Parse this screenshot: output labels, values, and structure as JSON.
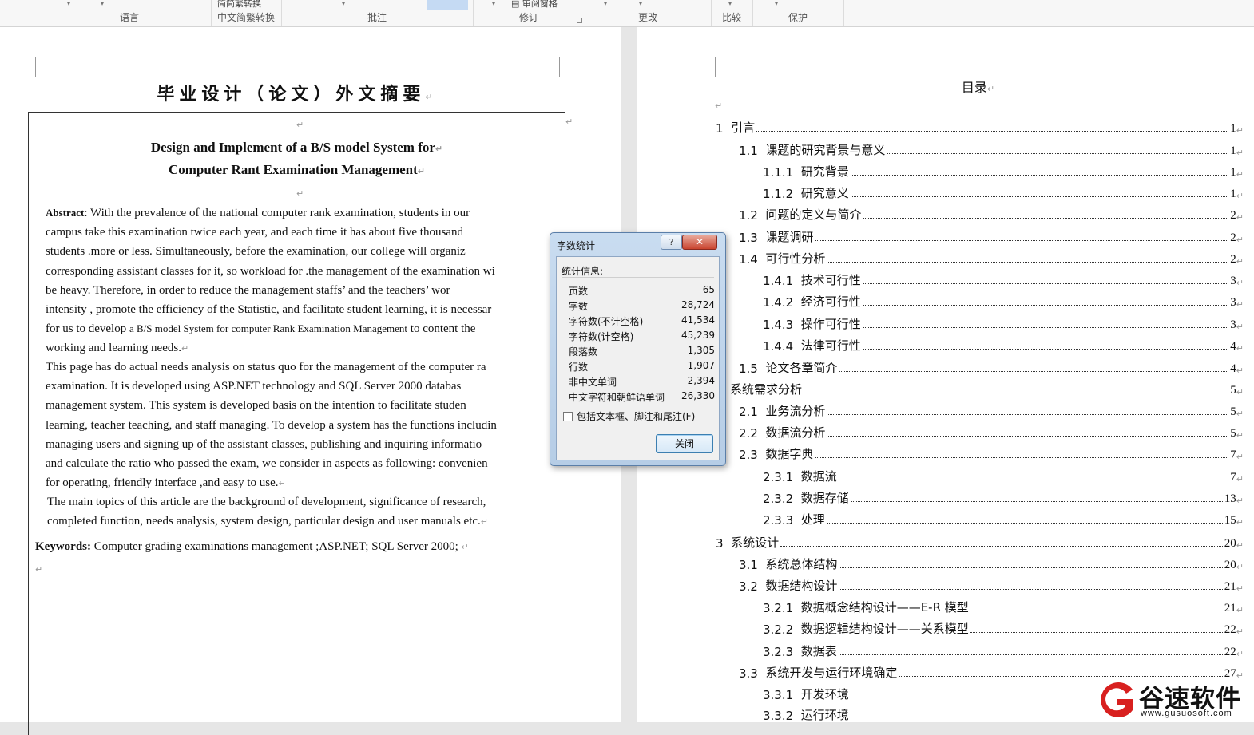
{
  "ribbon": {
    "groups": [
      {
        "label": "语言"
      },
      {
        "label": "中文简繁转换",
        "control": "简繁转换"
      },
      {
        "label": "批注"
      },
      {
        "label": "修订",
        "control": "审阅窗格"
      },
      {
        "label": "更改"
      },
      {
        "label": "比较"
      },
      {
        "label": "保护"
      }
    ]
  },
  "left_page": {
    "heading": "毕业设计（论文）外文摘要",
    "title_line1": "Design and Implement of a B/S model System for",
    "title_line2": "Computer Rant Examination Management",
    "abstract_label": "Abstract",
    "abstract_lines": [
      ": With the prevalence of the national computer rank examination, students in our",
      "campus take this examination twice each year, and each time it has about five thousand",
      "students .more or less. Simultaneously, before the examination, our college will organiz",
      "corresponding assistant classes for it, so workload for .the management of the examination wi",
      "be heavy. Therefore, in order to reduce the management staffs’ and the teachers’ wor",
      "intensity , promote the efficiency of the Statistic, and facilitate student learning, it is necessar",
      "for us to develop ",
      "working and learning needs."
    ],
    "abstract_line7_small": "a B/S model System for computer Rank Examination Management",
    "abstract_line7_end": " to content the",
    "para2_lines": [
      "This page has do actual needs analysis on status quo for the management of the computer ra",
      "examination. It is developed using ASP.NET technology and SQL Server 2000 databas",
      "management system. This system is developed basis on the intention to facilitate studen",
      "learning, teacher teaching, and staff managing. To develop a system has the functions includin",
      "managing users and signing up of the assistant classes, publishing and inquiring informatio",
      "and calculate the ratio who passed the exam, we consider in aspects as following: convenien",
      "for operating, friendly interface ,and easy to use."
    ],
    "para3_lines": [
      "The main topics of this article are the background of development, significance of research,",
      "completed function, needs analysis, system design, particular design and user manuals etc."
    ],
    "keywords_label": "Keywords:",
    "keywords_text": " Computer grading examinations management ;ASP.NET; SQL Server 2000; "
  },
  "toc": {
    "heading": "目录",
    "entries": [
      {
        "num": "1  ",
        "text": "引言",
        "page": "1"
      },
      {
        "num": "1.1  ",
        "text": "课题的研究背景与意义",
        "page": "1"
      },
      {
        "num": "1.1.1  ",
        "text": "研究背景",
        "page": "1"
      },
      {
        "num": "1.1.2  ",
        "text": "研究意义",
        "page": "1"
      },
      {
        "num": "1.2  ",
        "text": "问题的定义与简介",
        "page": "2"
      },
      {
        "num": "1.3  ",
        "text": "课题调研",
        "page": "2"
      },
      {
        "num": "1.4  ",
        "text": "可行性分析",
        "page": "2"
      },
      {
        "num": "1.4.1  ",
        "text": "技术可行性",
        "page": "3"
      },
      {
        "num": "1.4.2  ",
        "text": "经济可行性",
        "page": "3"
      },
      {
        "num": "1.4.3  ",
        "text": "操作可行性",
        "page": "3"
      },
      {
        "num": "1.4.4  ",
        "text": "法律可行性",
        "page": "4"
      },
      {
        "num": "1.5  ",
        "text": "论文各章简介",
        "page": "4"
      },
      {
        "num": "",
        "text": "系统需求分析",
        "page": "5"
      },
      {
        "num": "2.1  ",
        "text": "业务流分析",
        "page": "5"
      },
      {
        "num": "2.2  ",
        "text": "数据流分析",
        "page": "5"
      },
      {
        "num": "2.3  ",
        "text": "数据字典",
        "page": "7"
      },
      {
        "num": "2.3.1  ",
        "text": "数据流",
        "page": "7"
      },
      {
        "num": "2.3.2  ",
        "text": "数据存储",
        "page": "13"
      },
      {
        "num": "2.3.3  ",
        "text": "处理",
        "page": "15"
      },
      {
        "num": "3  ",
        "text": "系统设计",
        "page": "20"
      },
      {
        "num": "3.1  ",
        "text": "系统总体结构",
        "page": "20"
      },
      {
        "num": "3.2  ",
        "text": "数据结构设计",
        "page": "21"
      },
      {
        "num": "3.2.1  ",
        "text": "数据概念结构设计——E-R 模型",
        "page": "21"
      },
      {
        "num": "3.2.2  ",
        "text": "数据逻辑结构设计——关系模型",
        "page": "22"
      },
      {
        "num": "3.2.3  ",
        "text": "数据表",
        "page": "22"
      },
      {
        "num": "3.3  ",
        "text": "系统开发与运行环境确定",
        "page": "27"
      },
      {
        "num": "3.3.1  ",
        "text": "开发环境",
        "page": ""
      },
      {
        "num": "3.3.2  ",
        "text": "运行环境",
        "page": ""
      }
    ]
  },
  "dialog": {
    "title": "字数统计",
    "help": "?",
    "close_glyph": "✕",
    "stats_label": "统计信息:",
    "stats": [
      {
        "label": "页数",
        "value": "65"
      },
      {
        "label": "字数",
        "value": "28,724"
      },
      {
        "label": "字符数(不计空格)",
        "value": "41,534"
      },
      {
        "label": "字符数(计空格)",
        "value": "45,239"
      },
      {
        "label": "段落数",
        "value": "1,305"
      },
      {
        "label": "行数",
        "value": "1,907"
      },
      {
        "label": "非中文单词",
        "value": "2,394"
      },
      {
        "label": "中文字符和朝鲜语单词",
        "value": "26,330"
      }
    ],
    "include_label": "包括文本框、脚注和尾注(F)",
    "include_checked": false,
    "close_button": "关闭"
  },
  "watermark": {
    "name": "谷速软件",
    "url": "www.gusuosoft.com"
  },
  "colors": {
    "logo_red": "#d8201f",
    "dialog_frame": "#b6cde6"
  }
}
